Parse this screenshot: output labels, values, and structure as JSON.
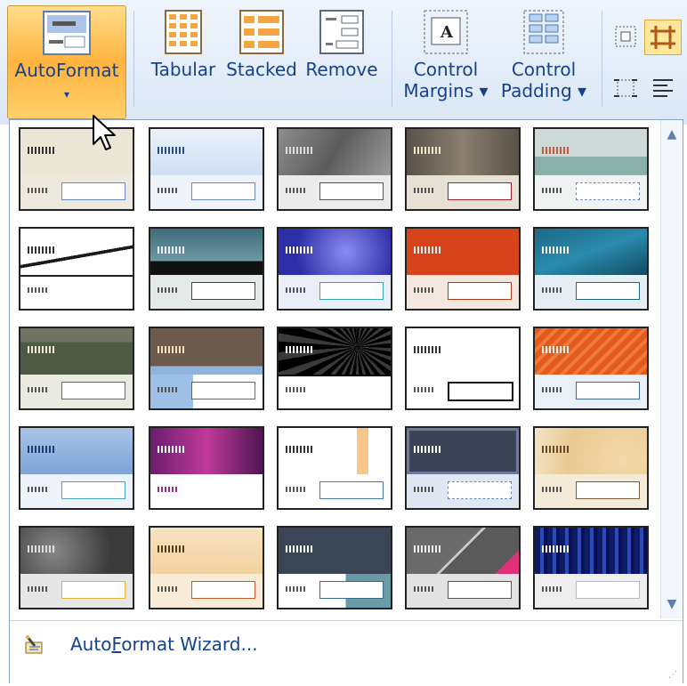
{
  "ribbon": {
    "autoformat_label": "AutoFormat",
    "autoformat_arrow": "▾",
    "tabular_label": "Tabular",
    "stacked_label": "Stacked",
    "remove_label": "Remove",
    "control_margins_line1": "Control",
    "control_margins_line2": "Margins ▾",
    "control_padding_line1": "Control",
    "control_padding_line2": "Padding ▾"
  },
  "gallery": {
    "scroll_up": "▲",
    "scroll_down": "▼"
  },
  "footer": {
    "wizard_label_pre": "Auto",
    "wizard_label_u": "F",
    "wizard_label_post": "ormat Wizard...",
    "grip": "⋰"
  },
  "colors": {
    "ribbon_text": "#15428b",
    "accent_orange": "#ffb340"
  }
}
